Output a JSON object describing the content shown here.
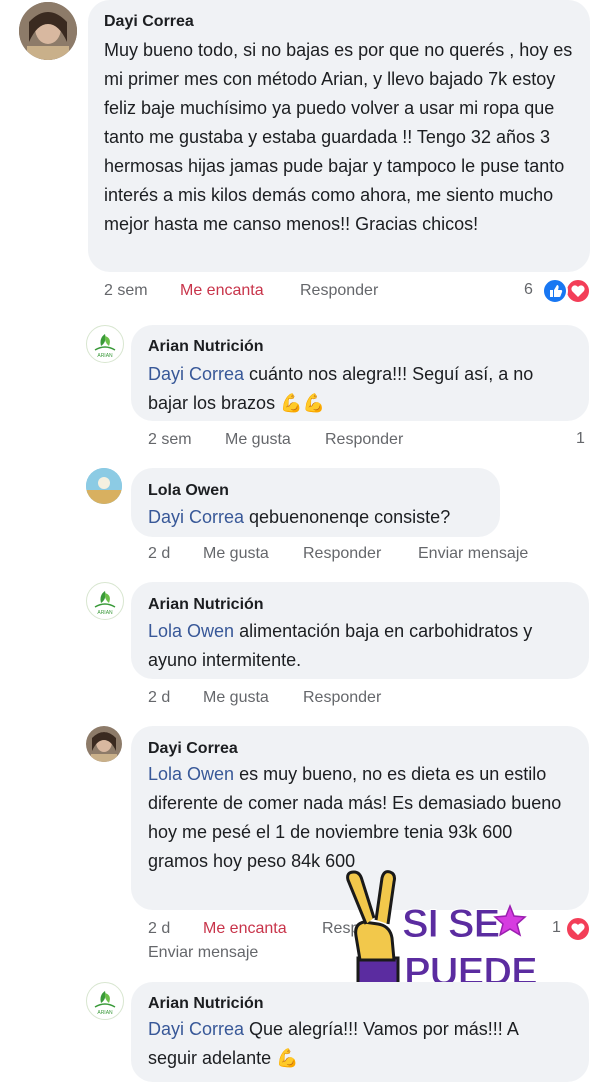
{
  "comments": [
    {
      "author": "Dayi Correa",
      "text": "Muy bueno todo, si no bajas es por que no querés , hoy es mi primer mes con método Arian, y llevo bajado 7k estoy  feliz baje muchísimo ya puedo volver a usar mi ropa que tanto me gustaba y estaba guardada !! Tengo 32 años 3 hermosas hijas jamas pude bajar y tampoco le puse tanto interés a mis kilos demás como ahora, me siento mucho mejor hasta me canso menos!! Gracias chicos!",
      "time": "2 sem",
      "like": "Me encanta",
      "reply": "Responder",
      "count": "6"
    },
    {
      "author": "Arian Nutrición",
      "mention": "Dayi Correa",
      "text": " cuánto nos alegra!!! Seguí así, a no bajar los brazos ",
      "emoji": "💪💪",
      "time": "2 sem",
      "like": "Me gusta",
      "reply": "Responder",
      "count": "1"
    },
    {
      "author": "Lola Owen",
      "mention": "Dayi Correa",
      "text": " qebuenonenqe consiste?",
      "time": "2 d",
      "like": "Me gusta",
      "reply": "Responder",
      "message": "Enviar mensaje"
    },
    {
      "author": "Arian Nutrición",
      "mention": "Lola Owen",
      "text": " alimentación baja en carbohidratos y ayuno intermitente.",
      "time": "2 d",
      "like": "Me gusta",
      "reply": "Responder"
    },
    {
      "author": "Dayi Correa",
      "mention": "Lola Owen",
      "text": " es muy bueno, no es dieta es un estilo diferente de comer nada más! Es demasiado bueno hoy me pesé el 1 de noviembre tenia 93k 600 gramos hoy peso 84k 600",
      "time": "2 d",
      "like": "Me encanta",
      "reply": "Resp",
      "message": "Enviar mensaje",
      "count": "1"
    },
    {
      "author": "Arian Nutrición",
      "mention": "Dayi Correa",
      "text": " Que alegría!!! Vamos por más!!! A seguir adelante ",
      "emoji": "💪"
    }
  ],
  "sticker": {
    "line1": "SI SE",
    "line2": "PUEDE"
  },
  "logo_text": "ARIAN",
  "colors": {
    "bubble": "#f0f2f5",
    "mention": "#385898",
    "love": "#c8344a",
    "like_blue": "#1877f2",
    "heart_red": "#f33e58"
  }
}
